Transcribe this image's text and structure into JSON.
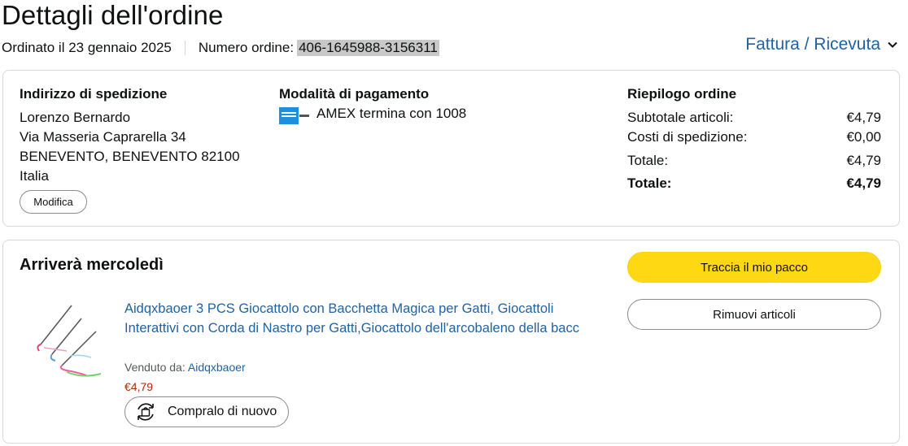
{
  "page": {
    "title": "Dettagli dell'ordine"
  },
  "meta": {
    "ordered_on": "Ordinato il 23 gennaio 2025",
    "order_number_label": "Numero ordine:",
    "order_number": "406-1645988-3156311"
  },
  "invoice": {
    "label": "Fattura / Ricevuta",
    "icon": "chevron-down-icon"
  },
  "shipping": {
    "heading": "Indirizzo di spedizione",
    "lines": [
      "Lorenzo Bernardo",
      "Via Masseria Caprarella 34",
      "BENEVENTO, BENEVENTO 82100",
      "Italia"
    ],
    "edit_label": "Modifica"
  },
  "payment": {
    "heading": "Modalità di pagamento",
    "card_icon": "amex-card-icon",
    "text": "AMEX termina con 1008"
  },
  "summary": {
    "heading": "Riepilogo ordine",
    "rows": [
      {
        "label": "Subtotale articoli:",
        "value": "€4,79"
      },
      {
        "label": "Costi di spedizione:",
        "value": "€0,00"
      },
      {
        "label": "Totale:",
        "value": "€4,79"
      },
      {
        "label": "Totale:",
        "value": "€4,79"
      }
    ]
  },
  "shipment": {
    "arrival": "Arriverà mercoledì",
    "track_label": "Traccia il mio pacco",
    "remove_label": "Rimuovi articoli",
    "product": {
      "title": "Aidqxbaoer 3 PCS Giocattolo con Bacchetta Magica per Gatti, Giocattoli Interattivi con Corda di Nastro per Gatti,Giocattolo dell'arcobaleno della bacc",
      "sold_by_label": "Venduto da:",
      "seller": "Aidqxbaoer",
      "price": "€4,79",
      "buy_again_label": "Compralo di nuovo",
      "buy_again_icon": "buy-again-icon"
    }
  },
  "colors": {
    "link": "#2162a1",
    "primary_button": "#ffd814",
    "price": "#b12704"
  }
}
